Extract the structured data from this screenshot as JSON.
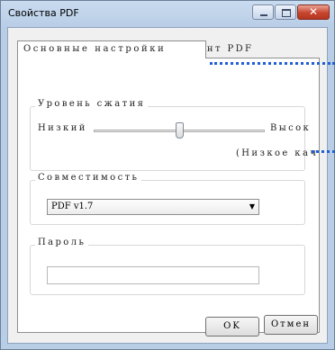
{
  "window": {
    "title": "Свойства PDF"
  },
  "tab": {
    "label": "Основные настройки"
  },
  "multipage": {
    "label": "Многостраничный документ PDF",
    "checked": true
  },
  "compression": {
    "group_label": "Уровень сжатия",
    "low_label": "Низкий",
    "high_label": "Высок",
    "level_text": "(Низкое кач",
    "slider_value": 0.5
  },
  "compatibility": {
    "group_label": "Совместимость",
    "selected": "PDF v1.7"
  },
  "password": {
    "group_label": "Пароль",
    "value": ""
  },
  "buttons": {
    "ok": "OK",
    "cancel": "Отмен"
  },
  "icons": {
    "checkmark": "checkmark-icon",
    "dropdown": "chevron-down-icon"
  },
  "colors": {
    "annotation_dots": "#1f5fd6"
  }
}
